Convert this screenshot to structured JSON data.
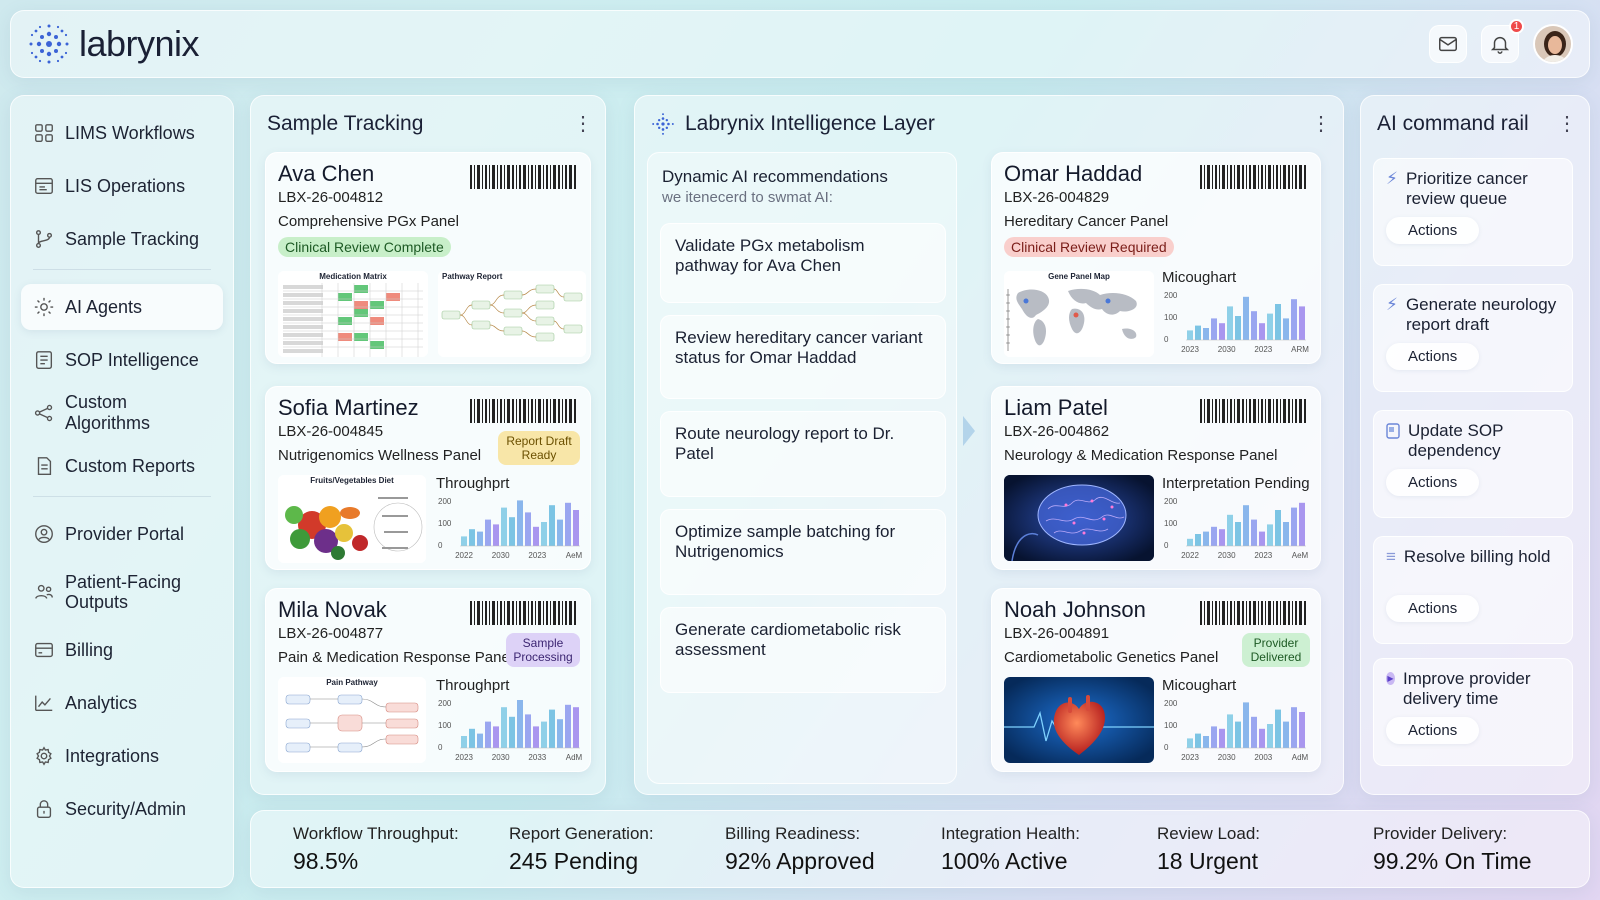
{
  "brand": {
    "name": "labrynix",
    "accent": "#3b63d6",
    "notifications": "1"
  },
  "sidebar": {
    "items": [
      {
        "label": "LIMS Workflows",
        "icon": "grid-icon"
      },
      {
        "label": "LIS Operations",
        "icon": "browser-icon"
      },
      {
        "label": "Sample Tracking",
        "icon": "branch-icon"
      },
      {
        "label": "AI Agents",
        "icon": "gear-icon"
      },
      {
        "label": "SOP Intelligence",
        "icon": "list-doc-icon"
      },
      {
        "label": "Custom Algorithms",
        "icon": "nodes-icon"
      },
      {
        "label": "Custom Reports",
        "icon": "report-icon"
      },
      {
        "label": "Provider Portal",
        "icon": "user-circle-icon"
      },
      {
        "label": "Patient-Facing Outputs",
        "icon": "users-icon"
      },
      {
        "label": "Billing",
        "icon": "card-icon"
      },
      {
        "label": "Analytics",
        "icon": "chart-icon"
      },
      {
        "label": "Integrations",
        "icon": "cog-icon"
      },
      {
        "label": "Security/Admin",
        "icon": "lock-icon"
      }
    ]
  },
  "tracking": {
    "title": "Sample Tracking",
    "cards": [
      {
        "name": "Ava Chen",
        "id": "LBX-26-004812",
        "panel": "Comprehensive PGx Panel",
        "status": "Clinical Review Complete",
        "thumb1": "Medication Matrix",
        "thumb2": "Pathway Report"
      },
      {
        "name": "Sofia Martinez",
        "id": "LBX-26-004845",
        "panel": "Nutrigenomics Wellness Panel",
        "status": "Report Draft Ready",
        "thumb": "Fruits/Vegetables Diet",
        "chart": "Throughprt",
        "x": [
          "2022",
          "2030",
          "2023",
          "AeM"
        ],
        "y": [
          "200",
          "100",
          "0"
        ],
        "values": [
          20,
          35,
          30,
          55,
          45,
          80,
          60,
          95,
          70,
          40,
          50,
          85,
          55,
          90,
          75
        ]
      },
      {
        "name": "Mila Novak",
        "id": "LBX-26-004877",
        "panel": "Pain & Medication Response Panel",
        "status": "Sample Processing",
        "thumb": "Pain Pathway",
        "chart": "Throughprt",
        "x": [
          "2023",
          "2030",
          "2033",
          "AdM"
        ],
        "y": [
          "200",
          "100",
          "0"
        ],
        "values": [
          25,
          40,
          30,
          55,
          45,
          85,
          65,
          100,
          70,
          45,
          55,
          80,
          60,
          90,
          85
        ]
      }
    ]
  },
  "intel": {
    "title": "Labrynix Intelligence Layer",
    "rec_title": "Dynamic AI recommendations",
    "rec_sub": "we itenecerd to swmat AI:",
    "recs": [
      "Validate PGx metabolism pathway for Ava Chen",
      "Review hereditary cancer variant status for Omar Haddad",
      "Route neurology report to Dr. Patel",
      "Optimize sample batching for Nutrigenomics",
      "Generate cardiometabolic risk assessment"
    ],
    "cards": [
      {
        "name": "Omar Haddad",
        "id": "LBX-26-004829",
        "panel": "Hereditary Cancer Panel",
        "status": "Clinical Review Required",
        "thumb": "Gene Panel Map",
        "chart": "Micoughart",
        "x": [
          "2023",
          "2030",
          "2023",
          "ARM"
        ],
        "y": [
          "200",
          "100",
          "0"
        ],
        "values": [
          20,
          30,
          25,
          45,
          35,
          70,
          50,
          90,
          60,
          35,
          55,
          75,
          45,
          85,
          70
        ]
      },
      {
        "name": "Liam Patel",
        "id": "LBX-26-004862",
        "panel": "Neurology & Medication Response Panel",
        "status": "Interpretation Pending",
        "chart": "Interpretation Pending",
        "x": [
          "2022",
          "2030",
          "2023",
          "AeM"
        ],
        "y": [
          "200",
          "100",
          "0"
        ],
        "values": [
          15,
          25,
          30,
          40,
          35,
          65,
          50,
          85,
          55,
          30,
          45,
          75,
          50,
          80,
          90
        ]
      },
      {
        "name": "Noah Johnson",
        "id": "LBX-26-004891",
        "panel": "Cardiometabolic Genetics Panel",
        "status": "Provider Delivered",
        "chart": "Micoughart",
        "x": [
          "2023",
          "2030",
          "2003",
          "AdM"
        ],
        "y": [
          "200",
          "100",
          "0"
        ],
        "values": [
          20,
          30,
          25,
          45,
          40,
          70,
          55,
          95,
          65,
          40,
          50,
          80,
          55,
          85,
          75
        ]
      }
    ]
  },
  "rail": {
    "title": "AI command rail",
    "items": [
      {
        "label": "Prioritize cancer review queue",
        "button": "Actions",
        "icon": "bolt-icon"
      },
      {
        "label": "Generate neurology report draft",
        "button": "Actions",
        "icon": "bolt-icon"
      },
      {
        "label": "Update SOP dependency",
        "button": "Actions",
        "icon": "doc-icon"
      },
      {
        "label": "Resolve billing hold",
        "button": "Actions",
        "icon": "lines-icon"
      },
      {
        "label": "Improve provider delivery time",
        "button": "Actions",
        "icon": "play-icon"
      }
    ]
  },
  "stats": [
    {
      "label": "Workflow Throughput:",
      "value": "98.5%"
    },
    {
      "label": "Report Generation:",
      "value": "245 Pending"
    },
    {
      "label": "Billing Readiness:",
      "value": "92% Approved"
    },
    {
      "label": "Integration Health:",
      "value": "100% Active"
    },
    {
      "label": "Review Load:",
      "value": "18 Urgent"
    },
    {
      "label": "Provider Delivery:",
      "value": "99.2% On Time"
    }
  ]
}
